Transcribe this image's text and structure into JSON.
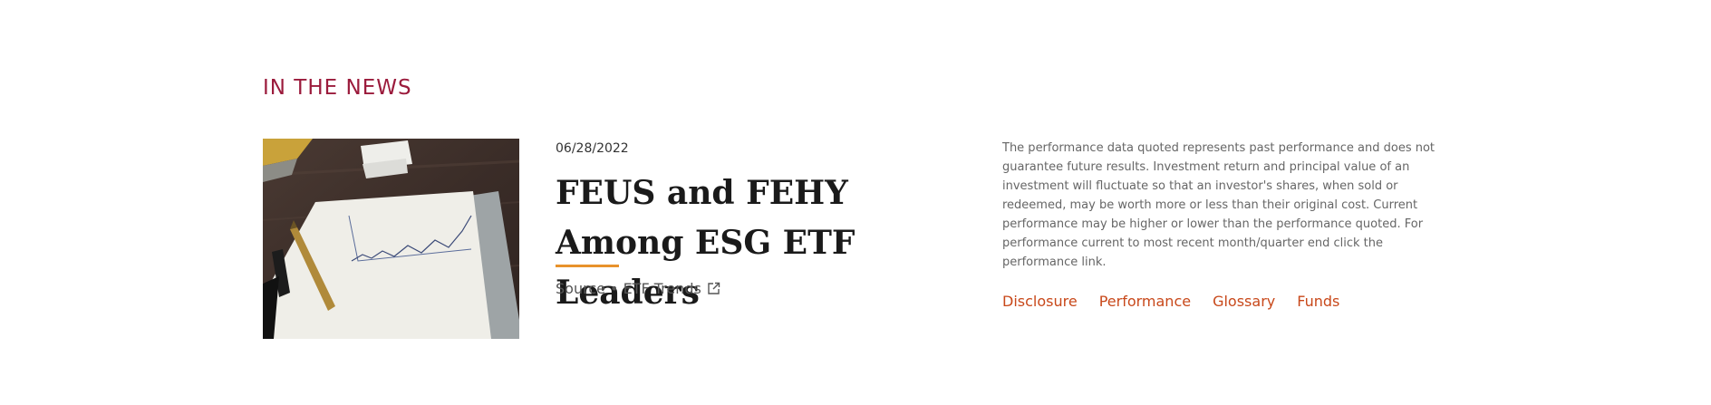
{
  "section": {
    "title": "IN THE NEWS"
  },
  "article": {
    "date": "06/28/2022",
    "headline": "FEUS and FEHY Among ESG ETF Leaders",
    "source": "Source • ETF Trends",
    "source_icon": "external-link-icon"
  },
  "disclaimer": {
    "text": "The performance data quoted represents past performance and does not guarantee future results. Investment return and principal value of an investment will fluctuate so that an investor's shares, when sold or redeemed, may be worth more or less than their original cost. Current performance may be higher or lower than the performance quoted. For performance current to most recent month/quarter end click the performance link."
  },
  "links": {
    "disclosure": "Disclosure",
    "performance": "Performance",
    "glossary": "Glossary",
    "funds": "Funds"
  },
  "colors": {
    "section_title": "#9b1b3c",
    "headline_underline": "#e8922c",
    "link": "#c8481a"
  }
}
